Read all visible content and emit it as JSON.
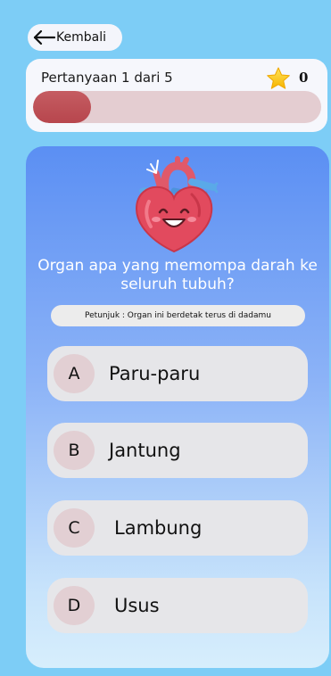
{
  "header": {
    "back_label": "Kembali"
  },
  "progress": {
    "text": "Pertanyaan 1 dari 5",
    "score": "0",
    "fraction": 0.2,
    "fill_color": "#b9484f",
    "track_color": "#e4cdd1"
  },
  "quiz": {
    "question": "Organ apa yang memompa darah ke seluruh tubuh?",
    "hint": "Petunjuk : Organ ini berdetak terus di dadamu",
    "options": [
      {
        "letter": "A",
        "text": "Paru-paru"
      },
      {
        "letter": "B",
        "text": "Jantung"
      },
      {
        "letter": "C",
        "text": "Lambung"
      },
      {
        "letter": "D",
        "text": "Usus"
      }
    ]
  },
  "colors": {
    "background": "#7dcdf6",
    "card_top": "#5b8ff3",
    "card_bottom": "#d7eefc"
  },
  "icons": {
    "back": "arrow-left-icon",
    "score": "star-icon",
    "illustration": "heart-illustration"
  }
}
